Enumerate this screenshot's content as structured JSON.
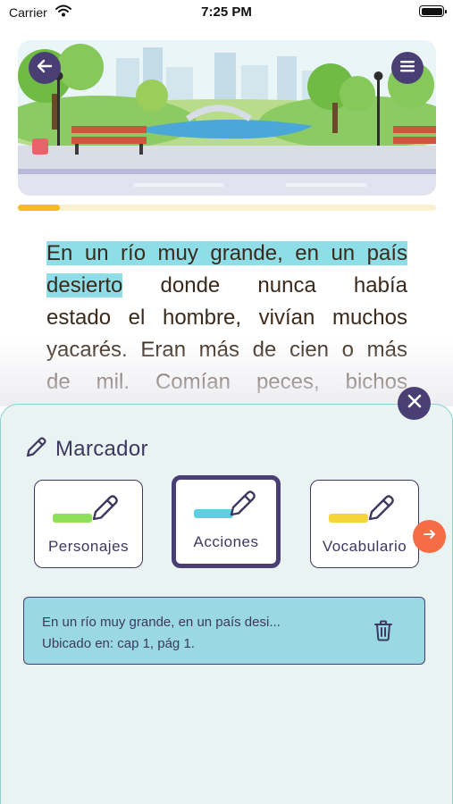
{
  "status_bar": {
    "carrier": "Carrier",
    "time": "7:25 PM"
  },
  "reader": {
    "progress_fraction": 0.1,
    "lines": [
      {
        "highlight": "En un río muy grande, en un país",
        "rest": ""
      },
      {
        "highlight": "desierto",
        "rest": " donde nunca había"
      },
      {
        "highlight": "",
        "rest": "estado el hombre, vivían muchos"
      },
      {
        "highlight": "",
        "rest": "yacarés. Eran más de cien o más"
      },
      {
        "highlight": "",
        "rest": "de mil. Comían peces, bichos"
      }
    ]
  },
  "marker_panel": {
    "title": "Marcador",
    "categories": [
      {
        "label": "Personajes",
        "color": "#8ee05a",
        "selected": false
      },
      {
        "label": "Acciones",
        "color": "#5ad0e0",
        "selected": true
      },
      {
        "label": "Vocabulario",
        "color": "#f5d53a",
        "selected": false
      }
    ],
    "saved_markers": [
      {
        "excerpt": "En un río muy grande, en un país desi...",
        "location": "Ubicado en: cap 1, pág 1."
      }
    ]
  },
  "icons": {
    "back": "arrow-left-icon",
    "menu": "hamburger-menu-icon",
    "close": "close-icon",
    "pencil": "pencil-icon",
    "next": "arrow-right-icon",
    "delete": "trash-icon"
  },
  "colors": {
    "primary": "#4a3f74",
    "accent_orange": "#f56d44",
    "progress": "#f5bb1f",
    "highlight": "#8fdde6",
    "panel_bg": "#e8f3f2",
    "marker_bg": "#9ad9e3"
  }
}
